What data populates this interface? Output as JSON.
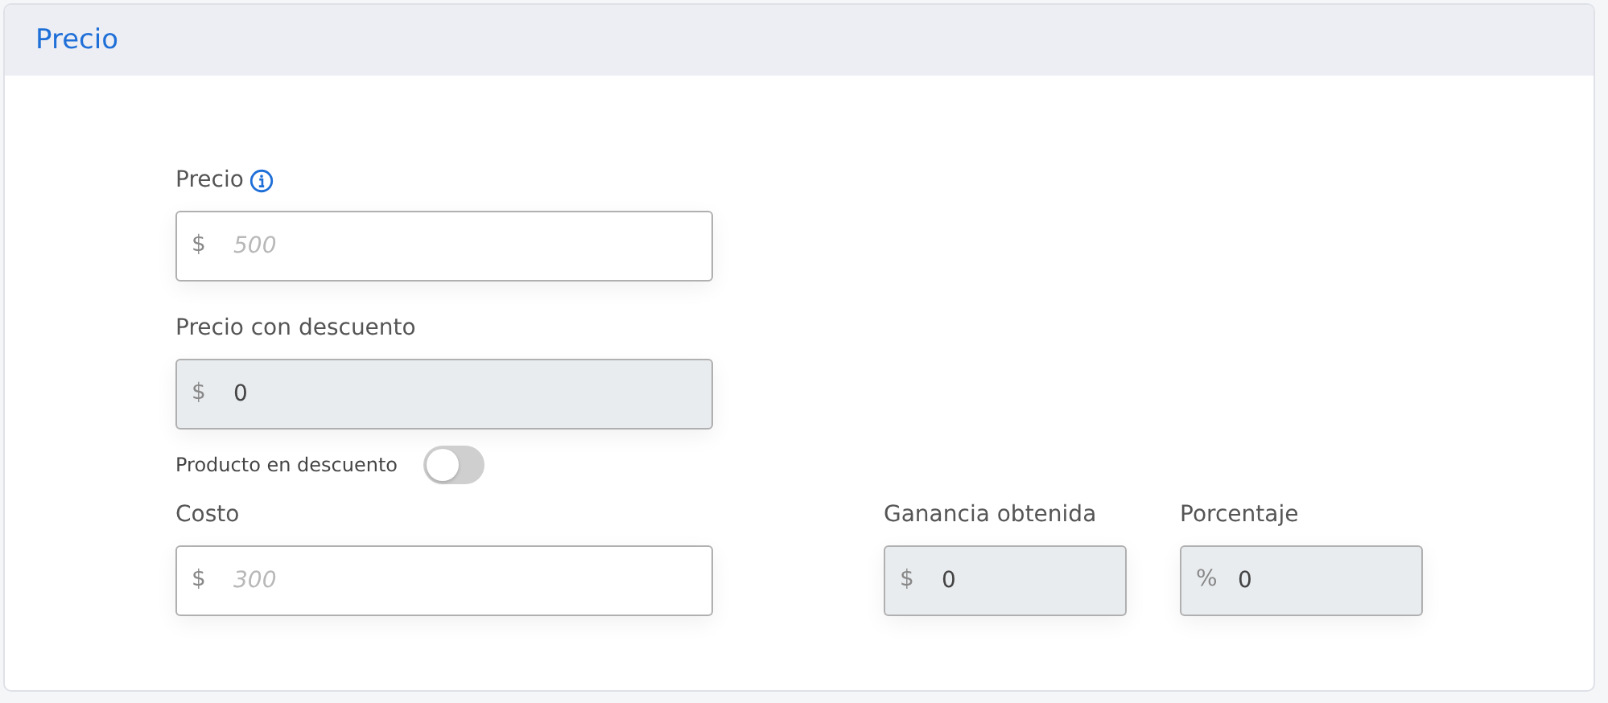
{
  "section": {
    "title": "Precio"
  },
  "price": {
    "label": "Precio",
    "prefix": "$",
    "placeholder": "500",
    "disabled": false
  },
  "discount_price": {
    "label": "Precio con descuento",
    "prefix": "$",
    "value": "0",
    "disabled": true
  },
  "discount_toggle": {
    "label": "Producto en descuento",
    "on": false
  },
  "cost": {
    "label": "Costo",
    "prefix": "$",
    "placeholder": "300",
    "disabled": false
  },
  "profit": {
    "label": "Ganancia obtenida",
    "prefix": "$",
    "value": "0",
    "disabled": true
  },
  "percentage": {
    "label": "Porcentaje",
    "prefix": "%",
    "value": "0",
    "disabled": true
  }
}
